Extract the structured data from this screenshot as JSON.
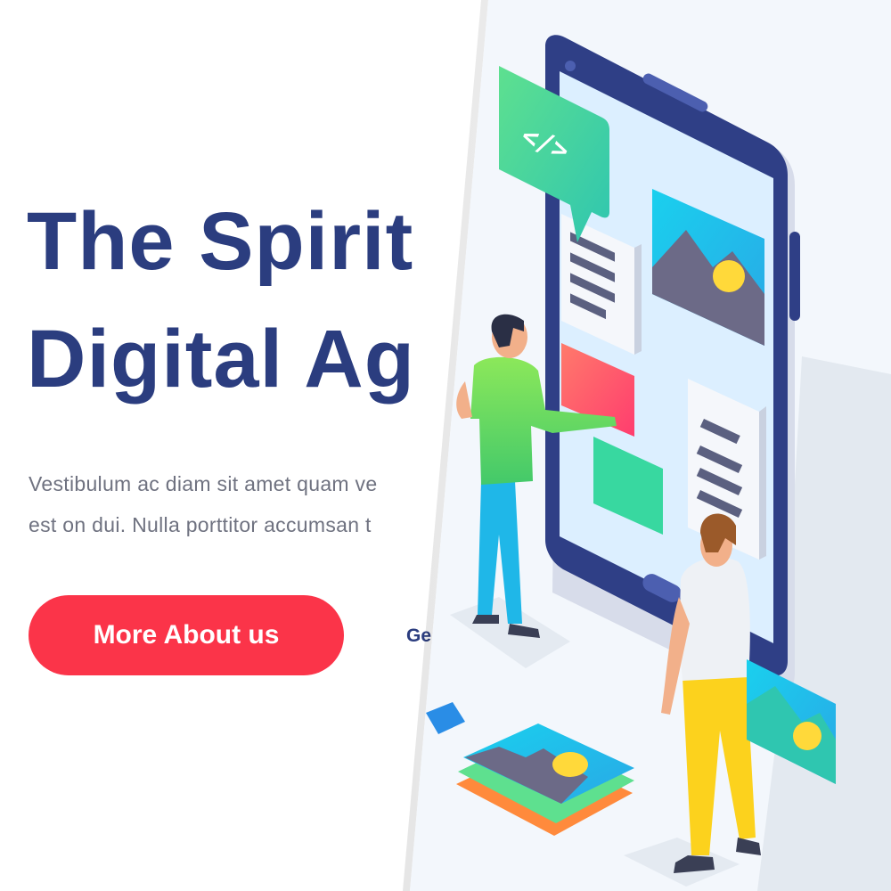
{
  "hero": {
    "headline_line1": "The Spirit",
    "headline_line2": "Digital Ag",
    "description_line1": "Vestibulum ac diam sit amet quam ve",
    "description_line2": "est on dui. Nulla porttitor accumsan t",
    "cta_label": "More About us",
    "secondary_label": "Ge"
  },
  "illustration": {
    "code_bubble_text": "</>",
    "icons": [
      "code-icon",
      "image-icon",
      "phone-icon"
    ]
  },
  "colors": {
    "heading": "#2b3d7f",
    "accent": "#fb3449",
    "body_text": "#6f7280",
    "phone_frame": "#2f3f86",
    "screen": "#dcefff"
  }
}
